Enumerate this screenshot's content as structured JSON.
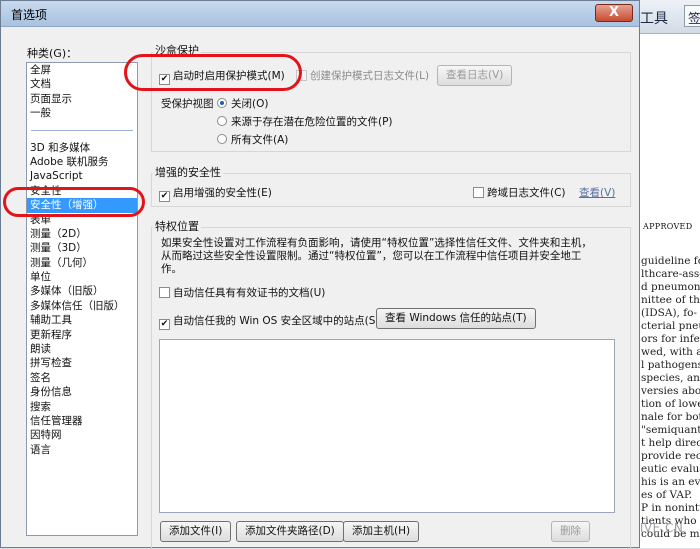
{
  "background": {
    "toolbar_tools_label": "工具",
    "toolbar_sign_label": "签",
    "doc_approved": "APPROVED",
    "doc_lines": [
      "guideline for",
      "lthcare-asso-",
      "d pneumonia",
      "nittee of the",
      "(IDSA), fo-",
      "cterial pneu-",
      "ors for infec-",
      "wed, with an",
      "l pathogens",
      "species, and",
      "versies about",
      "tion of lower",
      "nale for both",
      "\"semiquanti-",
      "t help direct",
      "provide rec-",
      "eutic evalua-",
      "his is an evi-",
      "es of VAP.",
      "P in nonintu-",
      "tients who",
      "could be man-"
    ],
    "watermark": "MEDLIVE.CN"
  },
  "dialog": {
    "title": "首选项",
    "close_glyph": "X",
    "category_label": "种类(G)：",
    "categories_top": [
      "全屏",
      "文档",
      "页面显示",
      "一般"
    ],
    "categories_bottom": [
      "3D 和多媒体",
      "Adobe 联机服务",
      "JavaScript",
      "安全性",
      "安全性（增强）",
      "表单",
      "测量（2D）",
      "测量（3D）",
      "测量（几何）",
      "单位",
      "多媒体（旧版）",
      "多媒体信任（旧版）",
      "辅助工具",
      "更新程序",
      "朗读",
      "拼写检查",
      "签名",
      "身份信息",
      "搜索",
      "信任管理器",
      "因特网",
      "语言"
    ],
    "selected_category": "安全性（增强）"
  },
  "sandbox": {
    "title": "沙盒保护",
    "protected_mode_label": "启动时启用保护模式(M)",
    "protected_mode_checked": true,
    "log_file_label": "创建保护模式日志文件(L)",
    "log_file_checked": false,
    "view_log_button": "查看日志(V)",
    "protected_view_label": "受保护视图",
    "options": [
      "关闭(O)",
      "来源于存在潜在危险位置的文件(P)",
      "所有文件(A)"
    ],
    "selected_option": "关闭(O)"
  },
  "enhanced": {
    "title": "增强的安全性",
    "enable_label": "启用增强的安全性(E)",
    "enable_checked": true,
    "cross_domain_label": "跨域日志文件(C)",
    "cross_domain_checked": false,
    "view_link": "查看(V)"
  },
  "privileged": {
    "title": "特权位置",
    "description_line1": "如果安全性设置对工作流程有负面影响，请使用“特权位置”选择性信任文件、文件夹和主机，",
    "description_line2": "从而略过这些安全性设置限制。通过“特权位置”，您可以在工作流程中信任项目并安全地工",
    "description_line3": "作。",
    "trust_certified_label": "自动信任具有有效证书的文档(U)",
    "trust_certified_checked": false,
    "trust_win_label": "自动信任我的 Win OS 安全区域中的站点(S)",
    "trust_win_checked": true,
    "view_windows_button": "查看 Windows 信任的站点(T)",
    "add_file_button": "添加文件(I)",
    "add_folder_button": "添加文件夹路径(D)",
    "add_host_button": "添加主机(H)",
    "delete_button": "删除"
  },
  "colors": {
    "selection": "#3399ff",
    "annotation_red": "#e4131a"
  }
}
